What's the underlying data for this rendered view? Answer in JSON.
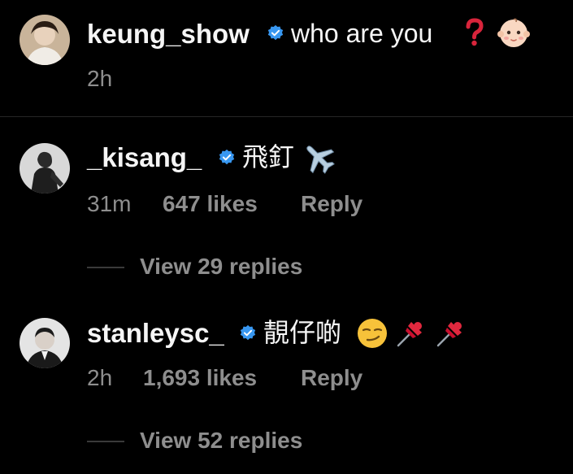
{
  "caption": {
    "username": "keung_show",
    "text": "who are you",
    "time": "2h",
    "emoji": [
      "question-mark-icon",
      "baby-face-icon"
    ]
  },
  "comments": [
    {
      "username": "_kisang_",
      "text": "飛釘",
      "emoji": [
        "airplane-icon"
      ],
      "time": "31m",
      "likes": "647 likes",
      "reply": "Reply",
      "view_replies": "View 29 replies"
    },
    {
      "username": "stanleysc_",
      "text": "靚仔啲",
      "emoji": [
        "smirking-face-icon",
        "pushpin-icon",
        "pushpin-icon"
      ],
      "time": "2h",
      "likes": "1,693 likes",
      "reply": "Reply",
      "view_replies": "View 52 replies"
    }
  ],
  "colors": {
    "background": "#000000",
    "text": "#f5f5f5",
    "secondary": "#8e8e8e",
    "verified": "#3897f0",
    "divider": "#262626"
  }
}
